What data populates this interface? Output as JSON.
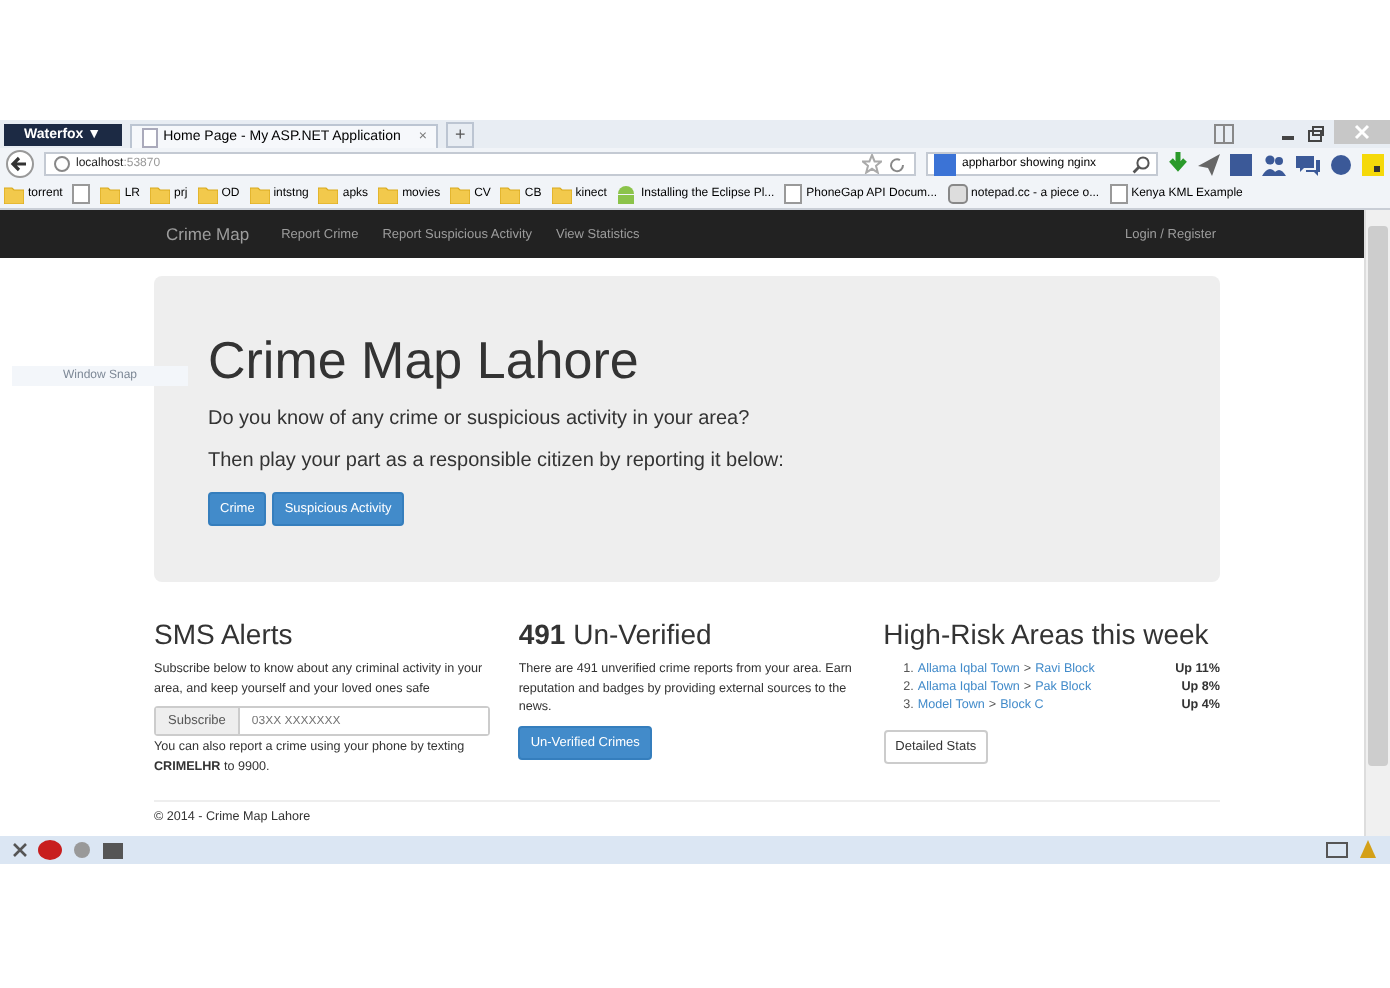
{
  "browser": {
    "app_button": "Waterfox ▼",
    "tab": {
      "title": "Home Page - My ASP.NET Application",
      "close": "×"
    },
    "new_tab": "+",
    "address": {
      "host": "localhost",
      "port": ":53870"
    },
    "search": {
      "value": "appharbor showing nginx"
    },
    "bookmarks": [
      {
        "label": "torrent",
        "kind": "folder"
      },
      {
        "kind": "page"
      },
      {
        "label": "LR",
        "kind": "folder"
      },
      {
        "label": "prj",
        "kind": "folder"
      },
      {
        "label": "OD",
        "kind": "folder"
      },
      {
        "label": "intstng",
        "kind": "folder"
      },
      {
        "label": "apks",
        "kind": "folder"
      },
      {
        "label": "movies",
        "kind": "folder"
      },
      {
        "label": "CV",
        "kind": "folder"
      },
      {
        "label": "CB",
        "kind": "folder"
      },
      {
        "label": "kinect",
        "kind": "folder"
      },
      {
        "label": "Installing the Eclipse Pl...",
        "kind": "android"
      },
      {
        "label": "PhoneGap API Docum...",
        "kind": "page"
      },
      {
        "label": "notepad.cc - a piece o...",
        "kind": "notepad"
      },
      {
        "label": "Kenya KML Example",
        "kind": "page"
      }
    ]
  },
  "navbar": {
    "brand": "Crime Map",
    "links": [
      "Report Crime",
      "Report Suspicious Activity",
      "View Statistics"
    ],
    "login": "Login / Register"
  },
  "overlay": {
    "label": "Window Snap"
  },
  "jumbotron": {
    "title": "Crime Map Lahore",
    "lead": "Do you know of any crime or suspicious activity in your area?",
    "text": "Then play your part as a responsible citizen by reporting it below:",
    "buttons": [
      "Crime",
      "Suspicious Activity"
    ]
  },
  "sms": {
    "title": "SMS Alerts",
    "text": "Subscribe below to know about any criminal activity in your area, and keep yourself and your loved ones safe",
    "addon": "Subscribe",
    "placeholder": "03XX XXXXXXX",
    "note": "You can also report a crime using your phone by texting **CRIMELHR** to 9900."
  },
  "unverified": {
    "count": "491",
    "title": "Un-Verified",
    "text": "There are 491 unverified crime reports from your area. Earn reputation and badges by providing external sources to the news.",
    "button": "Un-Verified Crimes"
  },
  "risk": {
    "title": "High-Risk Areas this week",
    "items": [
      {
        "num": "1.",
        "area": "Allama Iqbal Town",
        "block": "Ravi Block",
        "change": "Up 11%"
      },
      {
        "num": "2.",
        "area": "Allama Iqbal Town",
        "block": "Pak Block",
        "change": "Up 8%"
      },
      {
        "num": "3.",
        "area": "Model Town",
        "block": "Block C",
        "change": "Up 4%"
      }
    ],
    "sep": ">",
    "button": "Detailed Stats"
  },
  "footer": "© 2014 - Crime Map Lahore"
}
